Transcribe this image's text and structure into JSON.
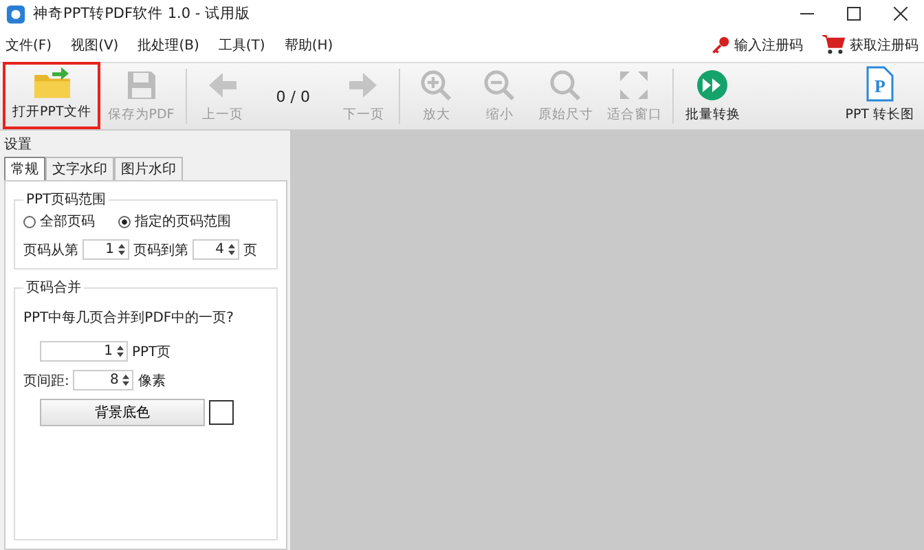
{
  "window": {
    "title": "神奇PPT转PDF软件 1.0 - 试用版"
  },
  "menu": [
    "文件(F)",
    "视图(V)",
    "批处理(B)",
    "工具(T)",
    "帮助(H)"
  ],
  "register_links": [
    {
      "kind": "key",
      "label": "输入注册码"
    },
    {
      "kind": "cart",
      "label": "获取注册码"
    }
  ],
  "toolbar": [
    {
      "kind": "open",
      "label": "打开PPT文件",
      "disabled": false
    },
    {
      "kind": "save",
      "label": "保存为PDF",
      "disabled": true
    },
    {
      "kind": "sep"
    },
    {
      "kind": "prev",
      "label": "上一页",
      "disabled": true
    },
    {
      "kind": "counter",
      "label": "0 / 0"
    },
    {
      "kind": "next",
      "label": "下一页",
      "disabled": true
    },
    {
      "kind": "sep"
    },
    {
      "kind": "zoomin",
      "label": "放大",
      "disabled": true
    },
    {
      "kind": "zoomout",
      "label": "缩小",
      "disabled": true
    },
    {
      "kind": "actual",
      "label": "原始尺寸",
      "disabled": true
    },
    {
      "kind": "fit",
      "label": "适合窗口",
      "disabled": true
    },
    {
      "kind": "sep"
    },
    {
      "kind": "batch",
      "label": "批量转换",
      "disabled": false
    },
    {
      "kind": "spacer"
    },
    {
      "kind": "long",
      "label": "PPT 转长图",
      "icon_letter": "P",
      "disabled": false
    }
  ],
  "settings": {
    "title": "设置",
    "tabs": [
      {
        "label": "常规",
        "selected": true
      },
      {
        "label": "文字水印",
        "selected": false
      },
      {
        "label": "图片水印",
        "selected": false
      }
    ],
    "page_range": {
      "title": "PPT页码范围",
      "options": [
        {
          "label": "全部页码",
          "selected": false
        },
        {
          "label": "指定的页码范围",
          "selected": true
        }
      ],
      "from_label": "页码从第",
      "from_value": "1",
      "to_label": "页码到第",
      "to_value": "4",
      "unit": "页"
    },
    "merge": {
      "title": "页码合并",
      "question": "PPT中每几页合并到PDF中的一页?",
      "pages_value": "1",
      "pages_unit": "PPT页",
      "spacing_label": "页间距:",
      "spacing_value": "8",
      "spacing_unit": "像素",
      "bg_button": "背景底色"
    }
  }
}
